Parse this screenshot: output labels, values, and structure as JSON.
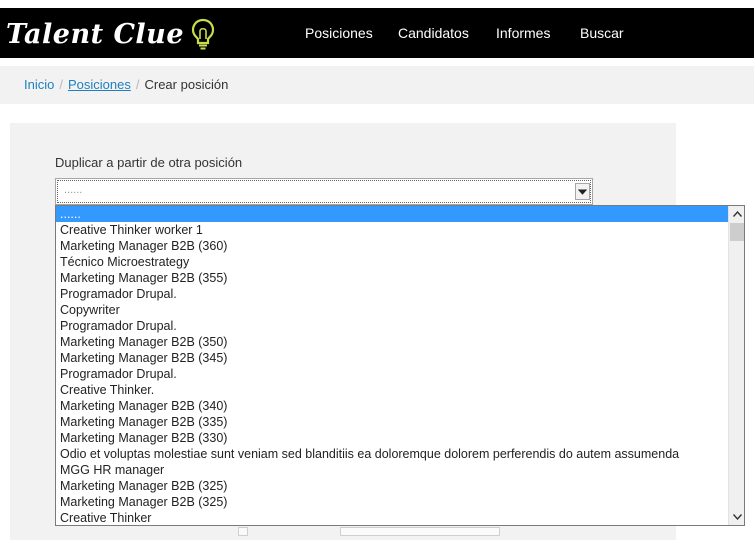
{
  "app": {
    "brand": "Talent Clue",
    "brand_icon": "lightbulb-icon",
    "nav": [
      "Posiciones",
      "Candidatos",
      "Informes",
      "Buscar"
    ]
  },
  "breadcrumb": {
    "home": "Inicio",
    "section": "Posiciones",
    "current": "Crear posición",
    "separator": "/"
  },
  "form": {
    "duplicate_label": "Duplicar a partir de otra posición",
    "select_value": "......",
    "options": [
      "......",
      "Creative Thinker worker 1",
      "Marketing Manager B2B (360)",
      "Técnico Microestrategy",
      "Marketing Manager B2B (355)",
      "Programador Drupal.",
      "Copywriter",
      "Programador Drupal.",
      "Marketing Manager B2B (350)",
      "Marketing Manager B2B (345)",
      "Programador Drupal.",
      "Creative Thinker.",
      "Marketing Manager B2B (340)",
      "Marketing Manager B2B (335)",
      "Marketing Manager B2B (330)",
      "Odio et voluptas molestiae sunt veniam sed blanditiis ea doloremque dolorem perferendis do autem assumenda",
      "MGG HR manager",
      "Marketing Manager B2B (325)",
      "Marketing Manager B2B (325)",
      "Creative Thinker"
    ],
    "selected_index": 0
  },
  "colors": {
    "navbar": "#000000",
    "link": "#1f7fbf",
    "highlight": "#3399ff",
    "panel": "#f2f2f2"
  }
}
